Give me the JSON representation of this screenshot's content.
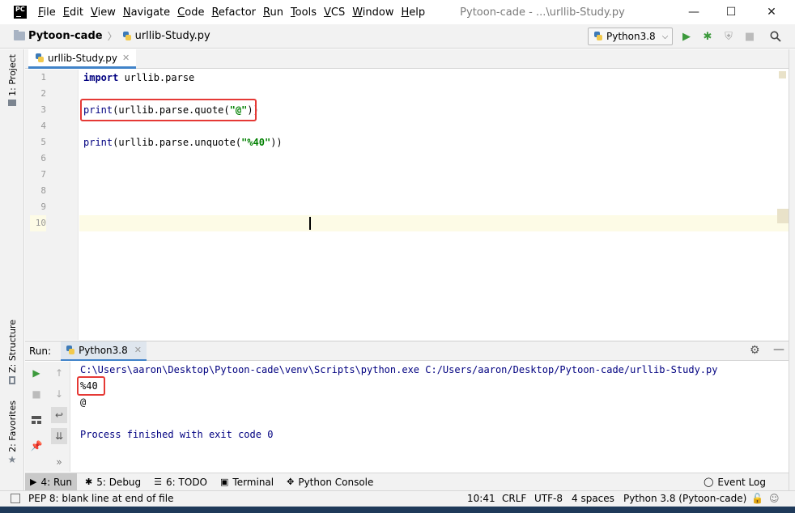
{
  "window": {
    "logo": "PC",
    "title": "Pytoon-cade - ...\\urllib-Study.py",
    "minimize": "—",
    "maximize": "☐",
    "close": "✕"
  },
  "menu": [
    {
      "mnemonic": "F",
      "rest": "ile"
    },
    {
      "mnemonic": "E",
      "rest": "dit"
    },
    {
      "mnemonic": "V",
      "rest": "iew"
    },
    {
      "mnemonic": "N",
      "rest": "avigate"
    },
    {
      "mnemonic": "C",
      "rest": "ode"
    },
    {
      "mnemonic": "R",
      "rest": "efactor"
    },
    {
      "mnemonic": "R",
      "rest": "un"
    },
    {
      "mnemonic": "T",
      "rest": "ools"
    },
    {
      "mnemonic": "V",
      "rest": "CS"
    },
    {
      "mnemonic": "W",
      "rest": "indow"
    },
    {
      "mnemonic": "H",
      "rest": "elp"
    }
  ],
  "navbar": {
    "project": "Pytoon-cade",
    "file": "urllib-Study.py",
    "run_config": "Python3.8"
  },
  "left_tabs": {
    "project": "1: Project",
    "structure": "Z: Structure",
    "favorites": "2: Favorites"
  },
  "editor": {
    "tab_label": "urllib-Study.py",
    "line_numbers": [
      "1",
      "2",
      "3",
      "4",
      "5",
      "6",
      "7",
      "8",
      "9",
      "10"
    ],
    "line1": {
      "kw": "import",
      "rest": " urllib.parse"
    },
    "line3": {
      "fn": "print",
      "a": "(urllib.parse.quote(",
      "str": "\"@\"",
      "b": "))"
    },
    "line5": {
      "fn": "print",
      "a": "(urllib.parse.unquote(",
      "str": "\"%40\"",
      "b": "))"
    }
  },
  "run_panel": {
    "label": "Run:",
    "tab": "Python3.8",
    "console": [
      "C:\\Users\\aaron\\Desktop\\Pytoon-cade\\venv\\Scripts\\python.exe C:/Users/aaron/Desktop/Pytoon-cade/urllib-Study.py",
      "%40",
      "@",
      "",
      "Process finished with exit code 0"
    ]
  },
  "bottom_tools": {
    "run": "4: Run",
    "debug": "5: Debug",
    "todo": "6: TODO",
    "terminal": "Terminal",
    "python_console": "Python Console",
    "event_log": "Event Log"
  },
  "status": {
    "message": "PEP 8: blank line at end of file",
    "position": "10:41",
    "line_sep": "CRLF",
    "encoding": "UTF-8",
    "indent": "4 spaces",
    "interpreter": "Python 3.8 (Pytoon-cade)"
  },
  "colors": {
    "keyword": "#000080",
    "string": "#008000",
    "highlight_box": "#e53935",
    "accent": "#4083c9"
  }
}
